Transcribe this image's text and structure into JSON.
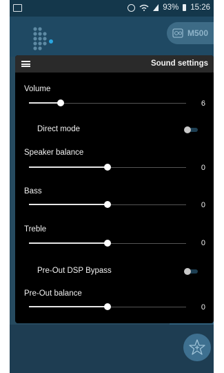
{
  "status_bar": {
    "battery": "93%",
    "time": "15:26"
  },
  "header": {
    "device_name": "M500"
  },
  "dialog": {
    "title": "Sound settings",
    "volume": {
      "label": "Volume",
      "value": "6",
      "level": 0.2
    },
    "direct_mode": {
      "label": "Direct mode",
      "on": false
    },
    "speaker_balance": {
      "label": "Speaker balance",
      "value": "0",
      "level": 0.5
    },
    "bass": {
      "label": "Bass",
      "value": "0",
      "level": 0.5
    },
    "treble": {
      "label": "Treble",
      "value": "0",
      "level": 0.5
    },
    "pre_out_dsp_bypass": {
      "label": "Pre-Out DSP Bypass",
      "on": false
    },
    "pre_out_balance": {
      "label": "Pre-Out balance",
      "value": "0",
      "level": 0.5
    }
  },
  "colors": {
    "status_bar": "#14374b",
    "app_background": "#264a5f",
    "dialog_background": "#000000",
    "dialog_titlebar": "#2a2a2a",
    "slider_fill": "#e6e6e6",
    "fab": "#3e7090"
  },
  "icons": {
    "status_left": "screen-icon",
    "status_right": [
      "sync-icon",
      "wifi-icon",
      "signal-icon",
      "battery-icon"
    ],
    "header_logo": "dot-grid-logo",
    "device": "speaker-box-icon",
    "dialog_menu": "hamburger-menu-icon",
    "fab": "star-plus-icon"
  }
}
